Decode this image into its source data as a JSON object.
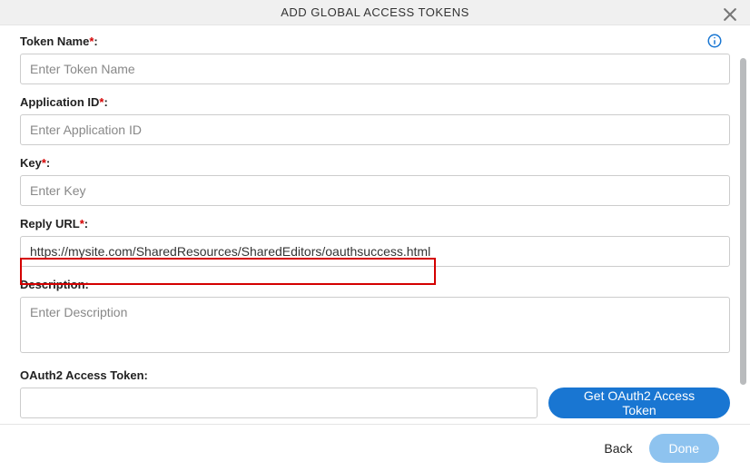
{
  "header": {
    "title": "ADD GLOBAL ACCESS TOKENS"
  },
  "fields": {
    "tokenName": {
      "label": "Token Name",
      "placeholder": "Enter Token Name",
      "value": ""
    },
    "applicationId": {
      "label": "Application ID",
      "placeholder": "Enter Application ID",
      "value": ""
    },
    "key": {
      "label": "Key",
      "placeholder": "Enter Key",
      "value": ""
    },
    "replyUrl": {
      "label": "Reply URL",
      "placeholder": "",
      "value": "https://mysite.com/SharedResources/SharedEditors/oauthsuccess.html"
    },
    "description": {
      "label": "Description:",
      "placeholder": "Enter Description",
      "value": ""
    },
    "oauthToken": {
      "label": "OAuth2 Access Token:",
      "value": ""
    }
  },
  "buttons": {
    "getToken": "Get OAuth2 Access Token",
    "back": "Back",
    "done": "Done"
  },
  "required_marker": "*",
  "colon": ":"
}
